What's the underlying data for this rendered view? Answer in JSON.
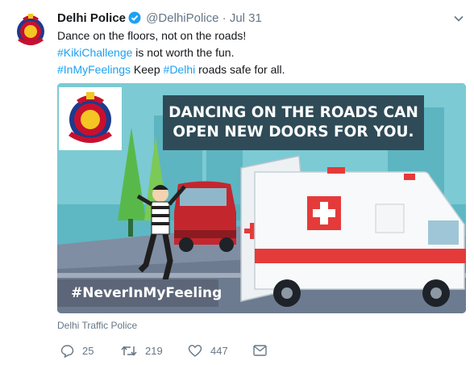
{
  "tweet": {
    "author_name": "Delhi Police",
    "handle": "@DelhiPolice",
    "separator": "·",
    "date": "Jul 31",
    "text_line1": "Dance on the floors, not on the roads!",
    "line2_hashtag": "#KikiChallenge",
    "line2_rest": " is not worth the fun.",
    "line3_hashtag1": "#InMyFeelings",
    "line3_mid": " Keep ",
    "line3_hashtag2": "#Delhi",
    "line3_rest": " roads safe for all."
  },
  "media": {
    "banner_line1": "DANCING ON THE ROADS CAN",
    "banner_line2": "OPEN NEW DOORS FOR YOU.",
    "hashtag_overlay": "#NeverInMyFeeling"
  },
  "credit": "Delhi Traffic Police",
  "actions": {
    "replies": "25",
    "retweets": "219",
    "likes": "447"
  },
  "colors": {
    "link": "#1da1f2",
    "muted": "#657786",
    "banner_bg": "#2f4b57",
    "ambulance_red": "#e53a3a"
  },
  "icons": [
    "police-logo-icon",
    "verified-badge-icon",
    "chevron-down-icon",
    "reply-icon",
    "retweet-icon",
    "like-icon",
    "message-icon"
  ]
}
